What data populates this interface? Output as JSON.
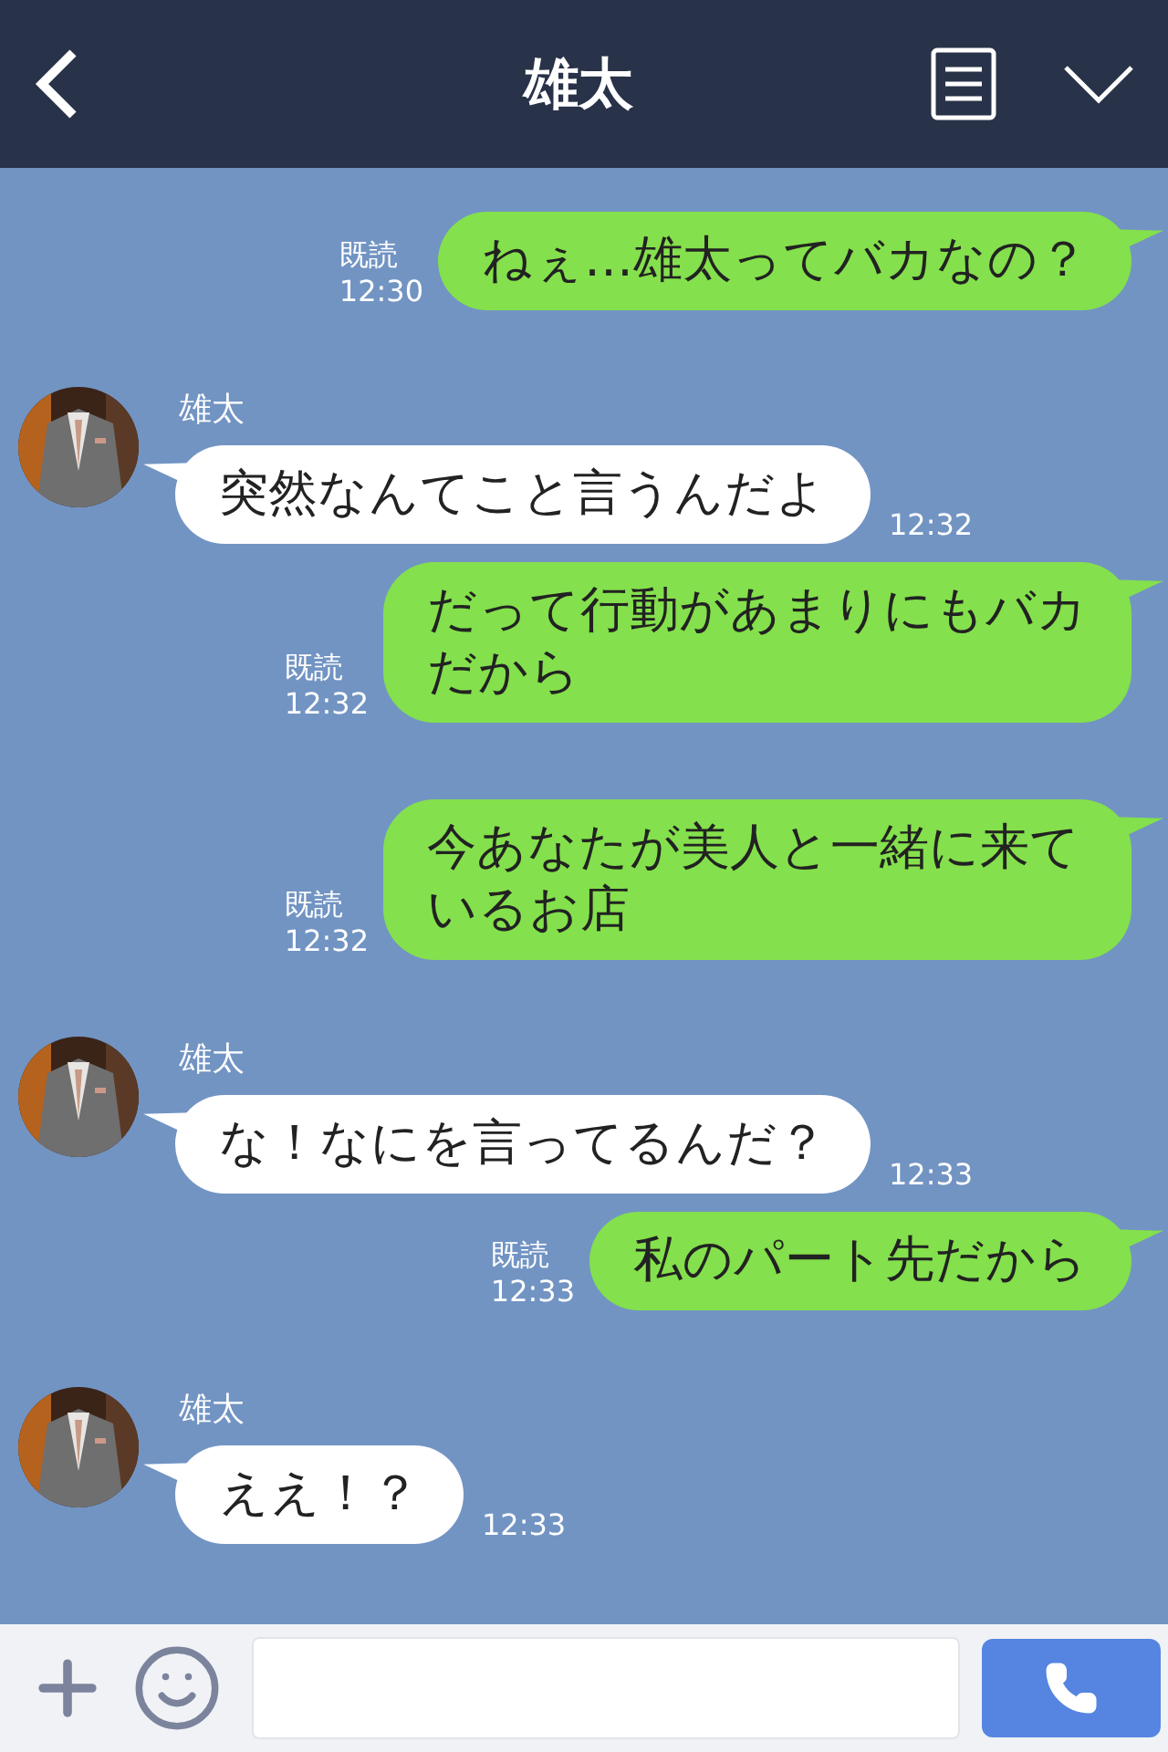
{
  "header": {
    "title": "雄太"
  },
  "messages": [
    {
      "kind": "sent",
      "text": "ねぇ…雄太ってバカなの？",
      "read": "既読",
      "time": "12:30"
    },
    {
      "kind": "received",
      "name": "雄太",
      "text": "突然なんてこと言うんだよ",
      "time": "12:32"
    },
    {
      "kind": "sent",
      "text": "だって行動があまりにもバカだから",
      "read": "既読",
      "time": "12:32"
    },
    {
      "kind": "sent",
      "text": "今あなたが美人と一緒に来ているお店",
      "read": "既読",
      "time": "12:32"
    },
    {
      "kind": "received",
      "name": "雄太",
      "text": "な！なにを言ってるんだ？",
      "time": "12:33"
    },
    {
      "kind": "sent",
      "text": "私のパート先だから",
      "read": "既読",
      "time": "12:33"
    },
    {
      "kind": "received",
      "name": "雄太",
      "text": "ええ！？",
      "time": "12:33"
    }
  ]
}
